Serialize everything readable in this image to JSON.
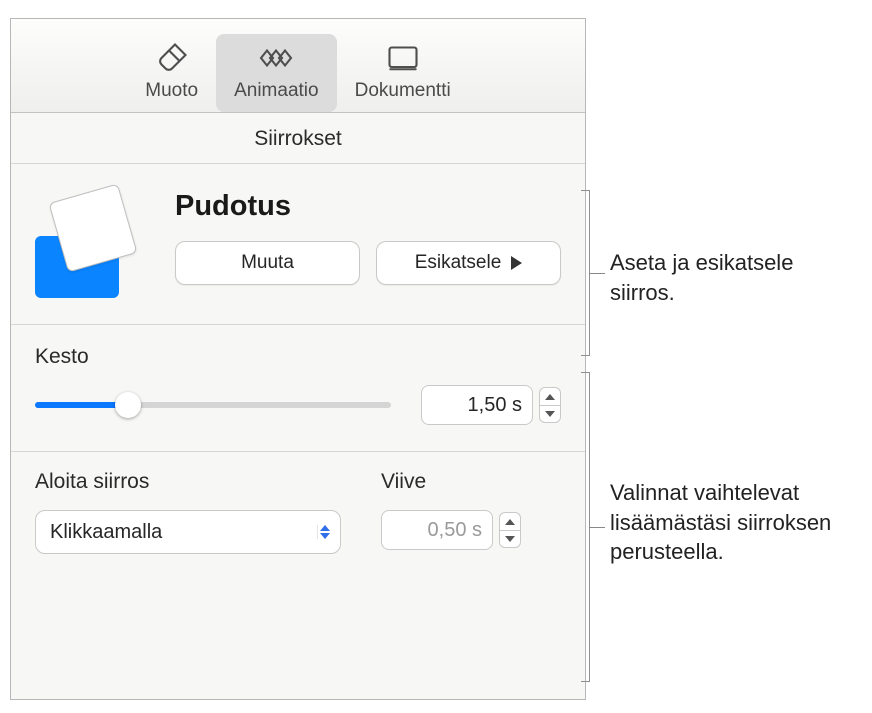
{
  "tabs": {
    "format": "Muoto",
    "animation": "Animaatio",
    "document": "Dokumentti"
  },
  "section_title": "Siirrokset",
  "transition": {
    "name": "Pudotus",
    "change_label": "Muuta",
    "preview_label": "Esikatsele"
  },
  "duration": {
    "label": "Kesto",
    "value": "1,50 s"
  },
  "start": {
    "label": "Aloita siirros",
    "value": "Klikkaamalla"
  },
  "delay": {
    "label": "Viive",
    "value": "0,50 s"
  },
  "callouts": {
    "top": "Aseta ja esikatsele siirros.",
    "bottom": "Valinnat vaihtelevat lisäämästäsi siirroksen perusteella."
  }
}
